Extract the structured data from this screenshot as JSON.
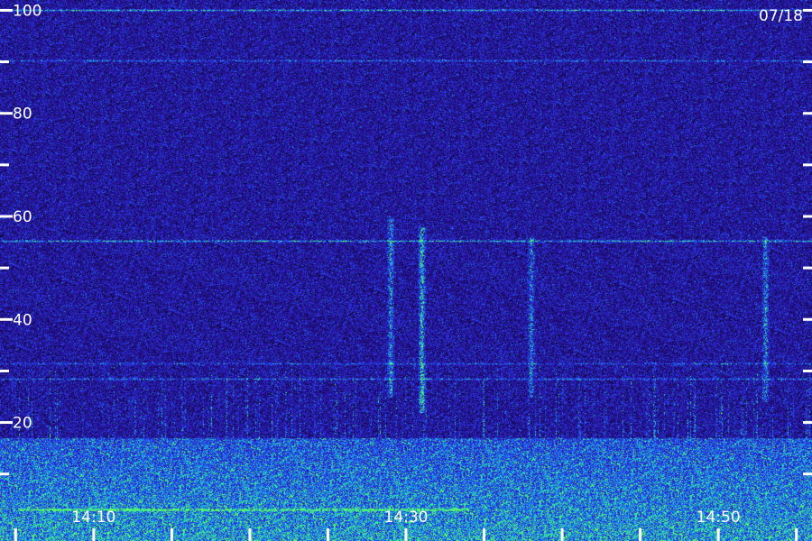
{
  "date_label": "07/18",
  "colors": {
    "background": "#1a0f52",
    "noise": "#3a20c8",
    "signal_low": "#1e5cff",
    "signal_high": "#3cff6a",
    "ticks": "#ffffff"
  },
  "chart_data": {
    "type": "heatmap",
    "title": "",
    "xlabel": "",
    "ylabel": "",
    "ylim": [
      -3,
      102
    ],
    "xlim": [
      "14:04",
      "14:56"
    ],
    "y_ticks": [
      10,
      20,
      30,
      40,
      50,
      60,
      70,
      80,
      90,
      100
    ],
    "y_tick_labels": [
      {
        "value": 20,
        "text": "20"
      },
      {
        "value": 40,
        "text": "40"
      },
      {
        "value": 60,
        "text": "60"
      },
      {
        "value": 80,
        "text": "80"
      },
      {
        "value": 100,
        "text": "100"
      }
    ],
    "x_ticks": [
      "14:05",
      "14:10",
      "14:15",
      "14:20",
      "14:25",
      "14:30",
      "14:35",
      "14:40",
      "14:45",
      "14:50",
      "14:55"
    ],
    "x_tick_labels": [
      {
        "time": "14:10",
        "text": "14:10"
      },
      {
        "time": "14:30",
        "text": "14:30"
      },
      {
        "time": "14:50",
        "text": "14:50"
      }
    ],
    "grid": false,
    "features": {
      "bright_low_band": {
        "y_from": -3,
        "y_to": 17
      },
      "horizontal_lines": [
        {
          "y": 100,
          "intensity": 0.55
        },
        {
          "y": 90.2,
          "intensity": 0.35
        },
        {
          "y": 55.2,
          "intensity": 0.55
        },
        {
          "y": 31.5,
          "intensity": 0.3
        },
        {
          "y": 28.5,
          "intensity": 0.35
        },
        {
          "y": 3.2,
          "intensity": 0.9,
          "t_from": "14:05",
          "t_to": "14:34"
        }
      ],
      "vertical_streaks": [
        {
          "time": "14:29",
          "y_from": 25,
          "y_to": 60,
          "intensity": 0.5
        },
        {
          "time": "14:31",
          "y_from": 22,
          "y_to": 58,
          "intensity": 0.65
        },
        {
          "time": "14:38",
          "y_from": 25,
          "y_to": 56,
          "intensity": 0.45
        },
        {
          "time": "14:53",
          "y_from": 24,
          "y_to": 56,
          "intensity": 0.5
        }
      ]
    }
  }
}
